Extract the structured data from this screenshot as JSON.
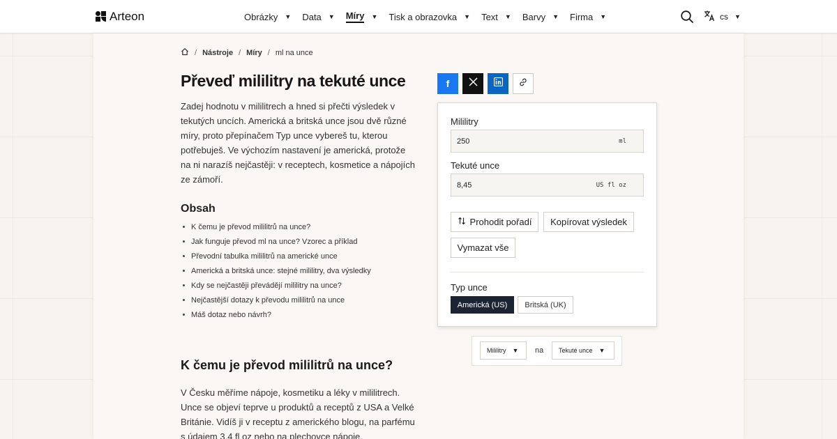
{
  "brand": {
    "name": "Arteon"
  },
  "nav": {
    "items": [
      {
        "label": "Obrázky"
      },
      {
        "label": "Data"
      },
      {
        "label": "Míry"
      },
      {
        "label": "Tisk a obrazovka"
      },
      {
        "label": "Text"
      },
      {
        "label": "Barvy"
      },
      {
        "label": "Firma"
      }
    ],
    "active_index": 2,
    "language": "cs"
  },
  "breadcrumb": [
    "Nástroje",
    "Míry",
    "ml na unce"
  ],
  "title": "Převeď mililitry na tekuté unce",
  "intro": "Zadej hodnotu v mililitrech a hned si přečti výsledek v tekutých uncích. Americká a britská unce jsou dvě různé míry, proto přepínačem Typ unce vybereš tu, kterou potřebuješ. Ve výchozím nastavení je americká, protože na ni narazíš nejčastěji: v receptech, kosmetice a nápojích ze zámoří.",
  "toc": {
    "title": "Obsah",
    "items": [
      "K čemu je převod mililitrů na unce?",
      "Jak funguje převod ml na unce? Vzorec a příklad",
      "Převodní tabulka mililitrů na americké unce",
      "Americká a britská unce: stejné mililitry, dva výsledky",
      "Kdy se nejčastěji převádějí mililitry na unce?",
      "Nejčastější dotazy k převodu mililitrů na unce",
      "Máš dotaz nebo návrh?"
    ]
  },
  "section": {
    "heading": "K čemu je převod mililitrů na unce?",
    "text": "V Česku měříme nápoje, kosmetiku a léky v mililitrech. Unce se objeví teprve u produktů a receptů z USA a Velké Británie. Vidíš ji v receptu z amerického blogu, na parfému s údajem 3,4 fl oz nebo na plechovce nápoje."
  },
  "share": {
    "facebook": "f"
  },
  "converter": {
    "from_label": "Mililitry",
    "from_value": "250",
    "from_unit": "ml",
    "to_label": "Tekuté unce",
    "to_value": "8,45",
    "to_unit": "US fl oz",
    "swap_label": "Prohodit pořadí",
    "copy_label": "Kopírovat výsledek",
    "clear_label": "Vymazat vše",
    "type_label": "Typ unce",
    "type_options": [
      "Americká (US)",
      "Britská (UK)"
    ],
    "type_selected": "Americká (US)"
  },
  "unit_switcher": {
    "from": "Mililitry",
    "joiner": "na",
    "to": "Tekuté unce"
  },
  "colors": {
    "background": "#f7f3ef",
    "facebook": "#1877f2",
    "x": "#111111",
    "linkedin": "#0a66c2",
    "selected_segment": "#1c2433"
  },
  "icons": [
    "home-icon",
    "search-icon",
    "translate-icon",
    "swap-icon",
    "link-icon",
    "x-icon",
    "linkedin-icon",
    "facebook-icon"
  ]
}
